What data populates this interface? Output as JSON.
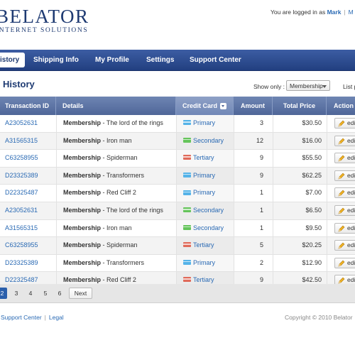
{
  "brand": {
    "logo_main": "BELATOR",
    "logo_sub": "INTERNET SOLUTIONS"
  },
  "header": {
    "logged_in_text": "You are logged in as",
    "user_name": "Mark",
    "link_partial": "M"
  },
  "nav": {
    "tabs": [
      "istory",
      "Shipping Info",
      "My Profile",
      "Settings",
      "Support Center"
    ],
    "active_index": 0
  },
  "page": {
    "title": "History"
  },
  "toolbar": {
    "show_only_label": "Show only :",
    "filter_value": "Membership",
    "list_label": "List p"
  },
  "table": {
    "columns": [
      "Transaction ID",
      "Details",
      "Credit Card",
      "Amount",
      "Total Price",
      "Action"
    ],
    "edit_label": "edi",
    "rows": [
      {
        "id": "A23052631",
        "product": "Membership",
        "detail": " - The lord of the rings",
        "card": "Primary",
        "amount": "3",
        "total": "$30.50"
      },
      {
        "id": "A31565315",
        "product": "Membership",
        "detail": " - Iron man",
        "card": "Secondary",
        "amount": "12",
        "total": "$16.00"
      },
      {
        "id": "C63258955",
        "product": "Membership",
        "detail": " - Spiderman",
        "card": "Tertiary",
        "amount": "9",
        "total": "$55.50"
      },
      {
        "id": "D23325389",
        "product": "Membership",
        "detail": " - Transformers",
        "card": "Primary",
        "amount": "9",
        "total": "$62.25"
      },
      {
        "id": "D22325487",
        "product": "Membership",
        "detail": " - Red Cliff 2",
        "card": "Primary",
        "amount": "1",
        "total": "$7.00"
      },
      {
        "id": "A23052631",
        "product": "Membership",
        "detail": " - The lord of the rings",
        "card": "Secondary",
        "amount": "1",
        "total": "$6.50"
      },
      {
        "id": "A31565315",
        "product": "Membership",
        "detail": " - Iron man",
        "card": "Secondary",
        "amount": "1",
        "total": "$9.50"
      },
      {
        "id": "C63258955",
        "product": "Membership",
        "detail": " - Spiderman",
        "card": "Tertiary",
        "amount": "5",
        "total": "$20.25"
      },
      {
        "id": "D23325389",
        "product": "Membership",
        "detail": " - Transformers",
        "card": "Primary",
        "amount": "2",
        "total": "$12.90"
      },
      {
        "id": "D22325487",
        "product": "Membership",
        "detail": " - Red Cliff 2",
        "card": "Tertiary",
        "amount": "9",
        "total": "$42.50"
      }
    ]
  },
  "card_colors": {
    "Primary": "#55b3e8",
    "Secondary": "#64c45a",
    "Tertiary": "#e06a5a"
  },
  "pagination": {
    "pages": [
      "2",
      "3",
      "4",
      "5",
      "6"
    ],
    "active": "2",
    "next_label": "Next"
  },
  "footer": {
    "links": [
      "Support Center",
      "Legal"
    ],
    "copyright": "Copyright © 2010 Belator"
  },
  "colors": {
    "brand": "#1e3a72",
    "nav": "#2c4a8c",
    "link": "#2a6ab4"
  }
}
